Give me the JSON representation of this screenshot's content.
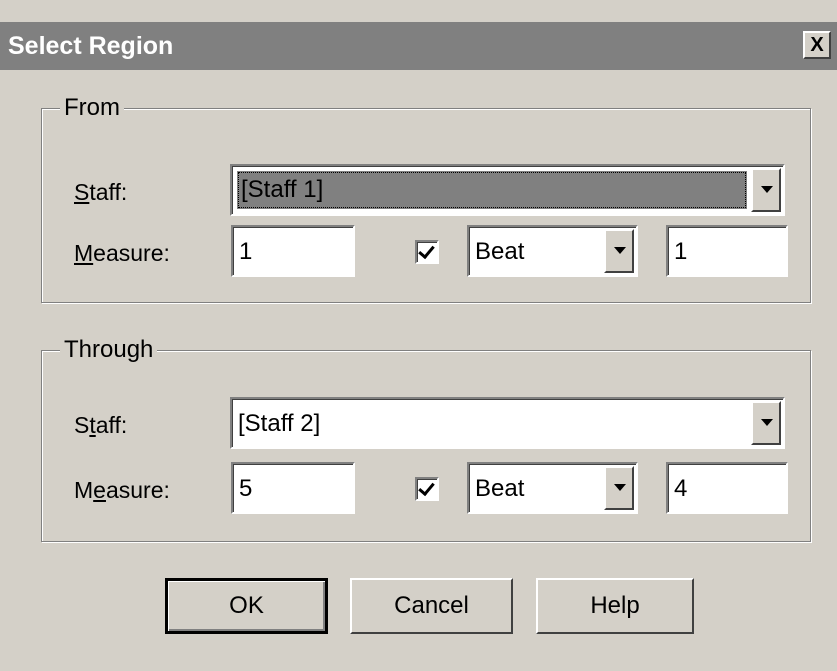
{
  "dialog": {
    "title": "Select Region",
    "close_label": "X"
  },
  "from": {
    "group_label": "From",
    "staff": {
      "label_prefix": "",
      "label_underline": "S",
      "label_suffix": "taff:",
      "value": "[Staff 1]"
    },
    "measure": {
      "label_prefix": "",
      "label_underline": "M",
      "label_suffix": "easure:",
      "value": "1",
      "checked": true,
      "unit": "Beat",
      "beat_value": "1"
    }
  },
  "through": {
    "group_label": "Through",
    "staff": {
      "label_prefix": "S",
      "label_underline": "t",
      "label_suffix": "aff:",
      "value": "[Staff 2]"
    },
    "measure": {
      "label_prefix": "M",
      "label_underline": "e",
      "label_suffix": "asure:",
      "value": "5",
      "checked": true,
      "unit": "Beat",
      "beat_value": "4"
    }
  },
  "buttons": {
    "ok": "OK",
    "cancel": "Cancel",
    "help": "Help"
  }
}
